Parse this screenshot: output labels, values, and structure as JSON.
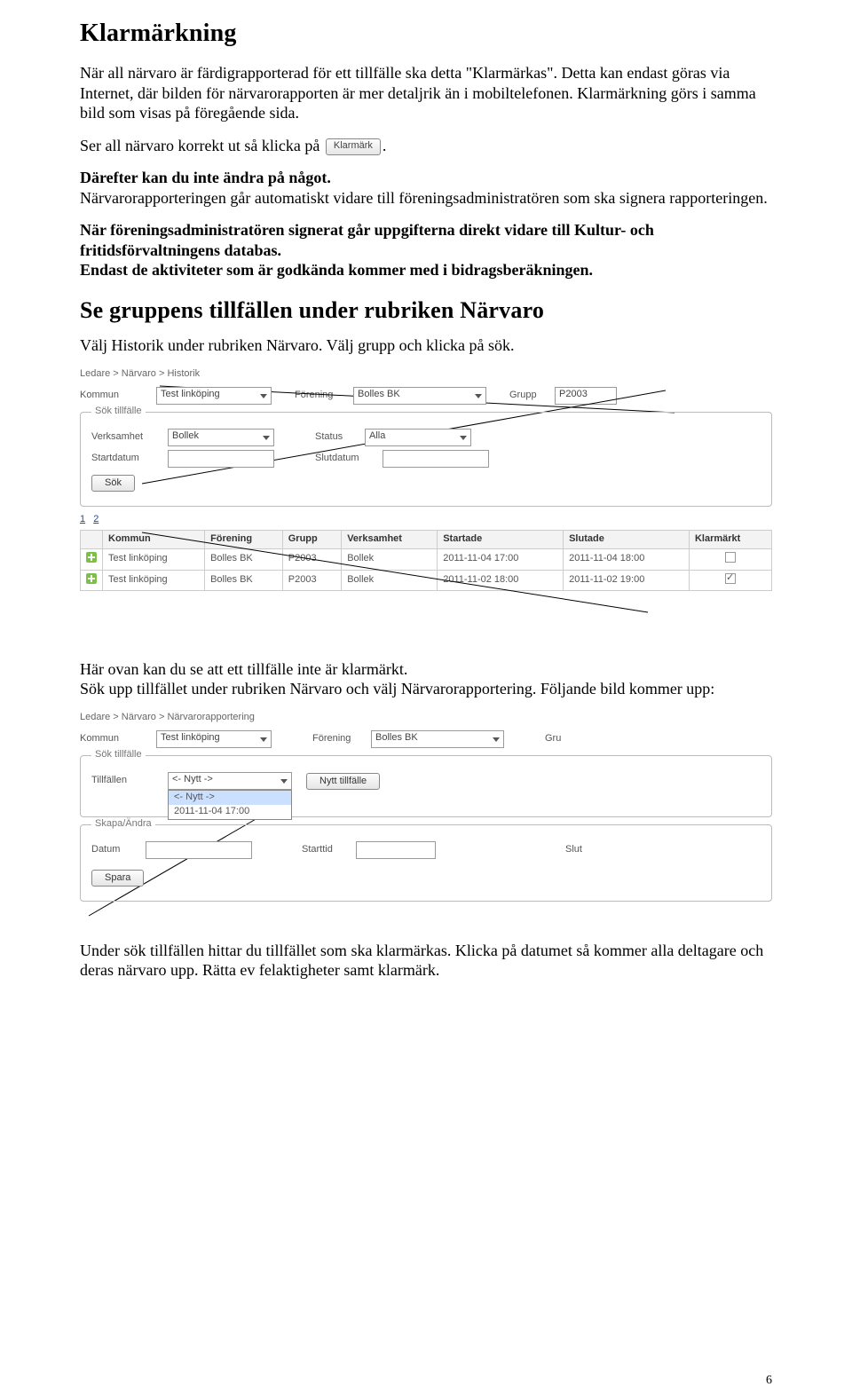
{
  "h1": "Klarmärkning",
  "p1": "När all närvaro är färdigrapporterad för ett tillfälle ska detta \"Klarmärkas\". Detta kan endast göras via Internet, där bilden för närvarorapporten är mer detaljrik än i mobiltelefonen. Klarmärkning görs i samma bild som visas på föregående sida.",
  "p2a": "Ser all närvaro korrekt ut så klicka på",
  "klarmark_btn": "Klarmärk",
  "p2b": ".",
  "p3": "Därefter kan du inte ändra på något.",
  "p4": "Närvarorapporteringen går automatiskt vidare till föreningsadministratören som ska signera rapporteringen.",
  "p5": "När föreningsadministratören signerat går uppgifterna direkt vidare till Kultur- och fritidsförvaltningens databas.",
  "p6": "Endast de aktiviteter som är godkända kommer med i bidragsberäkningen.",
  "h2": "Se gruppens tillfällen under rubriken Närvaro",
  "p7": "Välj Historik under rubriken Närvaro. Välj grupp och klicka på sök.",
  "shot1": {
    "crumb": "Ledare > Närvaro > Historik",
    "kommun_lbl": "Kommun",
    "kommun_val": "Test linköping",
    "forening_lbl": "Förening",
    "forening_val": "Bolles BK",
    "grupp_lbl": "Grupp",
    "grupp_val": "P2003",
    "sokbox": "Sök tillfälle",
    "verksamhet_lbl": "Verksamhet",
    "verksamhet_val": "Bollek",
    "status_lbl": "Status",
    "status_val": "Alla",
    "startdatum_lbl": "Startdatum",
    "slutdatum_lbl": "Slutdatum",
    "sok_btn": "Sök",
    "page1": "1",
    "page2": "2",
    "headers": [
      "",
      "Kommun",
      "Förening",
      "Grupp",
      "Verksamhet",
      "Startade",
      "Slutade",
      "Klarmärkt"
    ],
    "rows": [
      {
        "kommun": "Test linköping",
        "forening": "Bolles BK",
        "grupp": "P2003",
        "verk": "Bollek",
        "start": "2011-11-04 17:00",
        "slut": "2011-11-04 18:00",
        "klar": false
      },
      {
        "kommun": "Test linköping",
        "forening": "Bolles BK",
        "grupp": "P2003",
        "verk": "Bollek",
        "start": "2011-11-02 18:00",
        "slut": "2011-11-02 19:00",
        "klar": true
      }
    ]
  },
  "p8": "Här ovan kan du se att ett tillfälle inte är klarmärkt.",
  "p9": "Sök upp tillfället under rubriken Närvaro och välj Närvarorapportering. Följande bild kommer upp:",
  "shot2": {
    "crumb": "Ledare > Närvaro > Närvarorapportering",
    "kommun_lbl": "Kommun",
    "kommun_val": "Test linköping",
    "forening_lbl": "Förening",
    "forening_val": "Bolles BK",
    "gru_lbl": "Gru",
    "sokbox": "Sök tillfälle",
    "tillfallen_lbl": "Tillfällen",
    "dd_options": [
      "<- Nytt ->",
      "<- Nytt ->",
      "2011-11-04 17:00"
    ],
    "nytt_btn": "Nytt tillfälle",
    "skapa": "Skapa/Ändra",
    "datum_lbl": "Datum",
    "starttid_lbl": "Starttid",
    "slut_lbl": "Slut",
    "spara_btn": "Spara"
  },
  "p10": "Under sök tillfällen hittar du tillfället som ska klarmärkas. Klicka på datumet så kommer alla deltagare och deras närvaro upp. Rätta ev felaktigheter samt klarmärk.",
  "pagenum": "6"
}
